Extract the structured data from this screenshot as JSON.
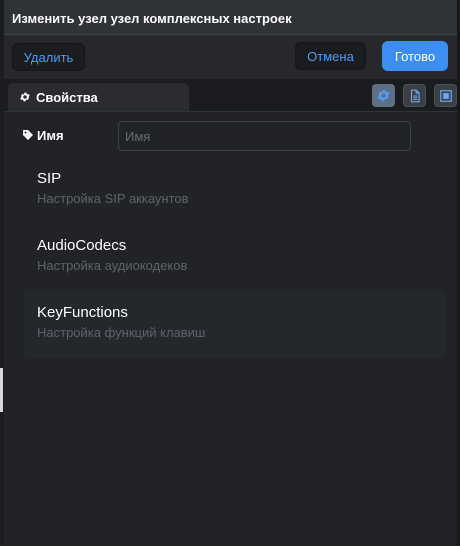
{
  "header": {
    "title": "Изменить узел узел комплексных настроек"
  },
  "toolbar": {
    "delete_label": "Удалить",
    "cancel_label": "Отмена",
    "done_label": "Готово"
  },
  "tabs": [
    {
      "label": "Свойства",
      "icon": "gear-icon"
    }
  ],
  "tab_tools": [
    {
      "icon": "gear-icon"
    },
    {
      "icon": "document-icon"
    },
    {
      "icon": "frame-icon"
    }
  ],
  "form": {
    "name_label": "Имя",
    "name_icon": "tag-icon",
    "name_value": "",
    "name_placeholder": "Имя"
  },
  "sections": [
    {
      "title": "SIP",
      "subtitle": "Настройка SIP аккаунтов"
    },
    {
      "title": "AudioCodecs",
      "subtitle": "Настройка аудиокодеков"
    },
    {
      "title": "KeyFunctions",
      "subtitle": "Настройка функций клавиш"
    }
  ],
  "colors": {
    "accent": "#3c8ef2",
    "link": "#4f9cf5",
    "background": "#212327",
    "header": "#2f3237"
  }
}
